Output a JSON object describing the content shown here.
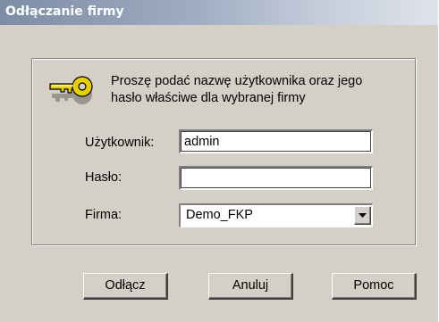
{
  "window": {
    "title": "Odłączanie firmy"
  },
  "info": {
    "message_line1": "Proszę podać nazwę użytkownika oraz jego",
    "message_line2": "hasło właściwe dla wybranej firmy",
    "icon": "key-icon"
  },
  "form": {
    "user_label": "Użytkownik:",
    "user_value": "admin",
    "password_label": "Hasło:",
    "password_value": "",
    "company_label": "Firma:",
    "company_value": "Demo_FKP"
  },
  "buttons": {
    "disconnect": "Odłącz",
    "cancel": "Anuluj",
    "help": "Pomoc"
  },
  "colors": {
    "face": "#d4d0c8",
    "key_yellow": "#e8d000",
    "title_gradient_start": "#7d8da6"
  }
}
